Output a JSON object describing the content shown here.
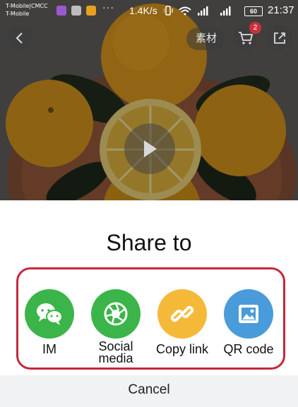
{
  "status_bar": {
    "carrier_1": "T-Mobile|CMCC",
    "carrier_2": "T-Mobile",
    "more": "···",
    "net_speed": "1.4K/s",
    "battery": "60",
    "time": "21:37",
    "app_icons": [
      "purple-app-icon",
      "gray-app-icon",
      "orange-app-icon"
    ]
  },
  "header": {
    "material_label": "素材",
    "cart_badge": "2"
  },
  "share_sheet": {
    "title": "Share to",
    "options": [
      {
        "label": "IM",
        "icon": "chat-bubbles-icon",
        "color": "#3bb54a"
      },
      {
        "label": "Social\nmedia",
        "icon": "aperture-icon",
        "color": "#3bb54a"
      },
      {
        "label": "Copy link",
        "icon": "link-icon",
        "color": "#f5b93a"
      },
      {
        "label": "QR code",
        "icon": "image-icon",
        "color": "#4a9bd9"
      }
    ],
    "highlight_color": "#c5283d",
    "cancel_label": "Cancel"
  }
}
